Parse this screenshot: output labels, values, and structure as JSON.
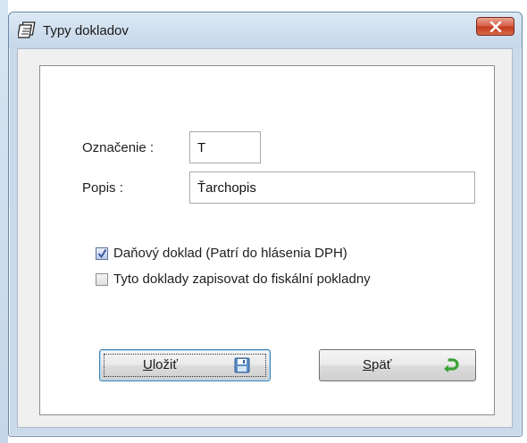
{
  "window": {
    "title": "Typy dokladov",
    "icon": "notebook-icon",
    "close_icon": "close-icon"
  },
  "form": {
    "oznacenie_label": "Označenie :",
    "oznacenie_value": "T",
    "popis_label": "Popis :",
    "popis_value": "Ťarchopis"
  },
  "checkboxes": [
    {
      "label": "Daňový doklad (Patrí do hlásenia DPH)",
      "checked": true
    },
    {
      "label": "Tyto doklady zapisovat do fiskální pokladny",
      "checked": false
    }
  ],
  "buttons": {
    "save": {
      "accel": "U",
      "rest": "ložiť",
      "icon": "floppy-disk-icon"
    },
    "back": {
      "accel": "S",
      "rest": "päť",
      "icon": "green-return-arrow-icon"
    }
  },
  "colors": {
    "titlebar": "#cfdeee",
    "close_button": "#c7432a",
    "checkbox_check": "#3a57a0",
    "back_arrow": "#3aa135"
  }
}
